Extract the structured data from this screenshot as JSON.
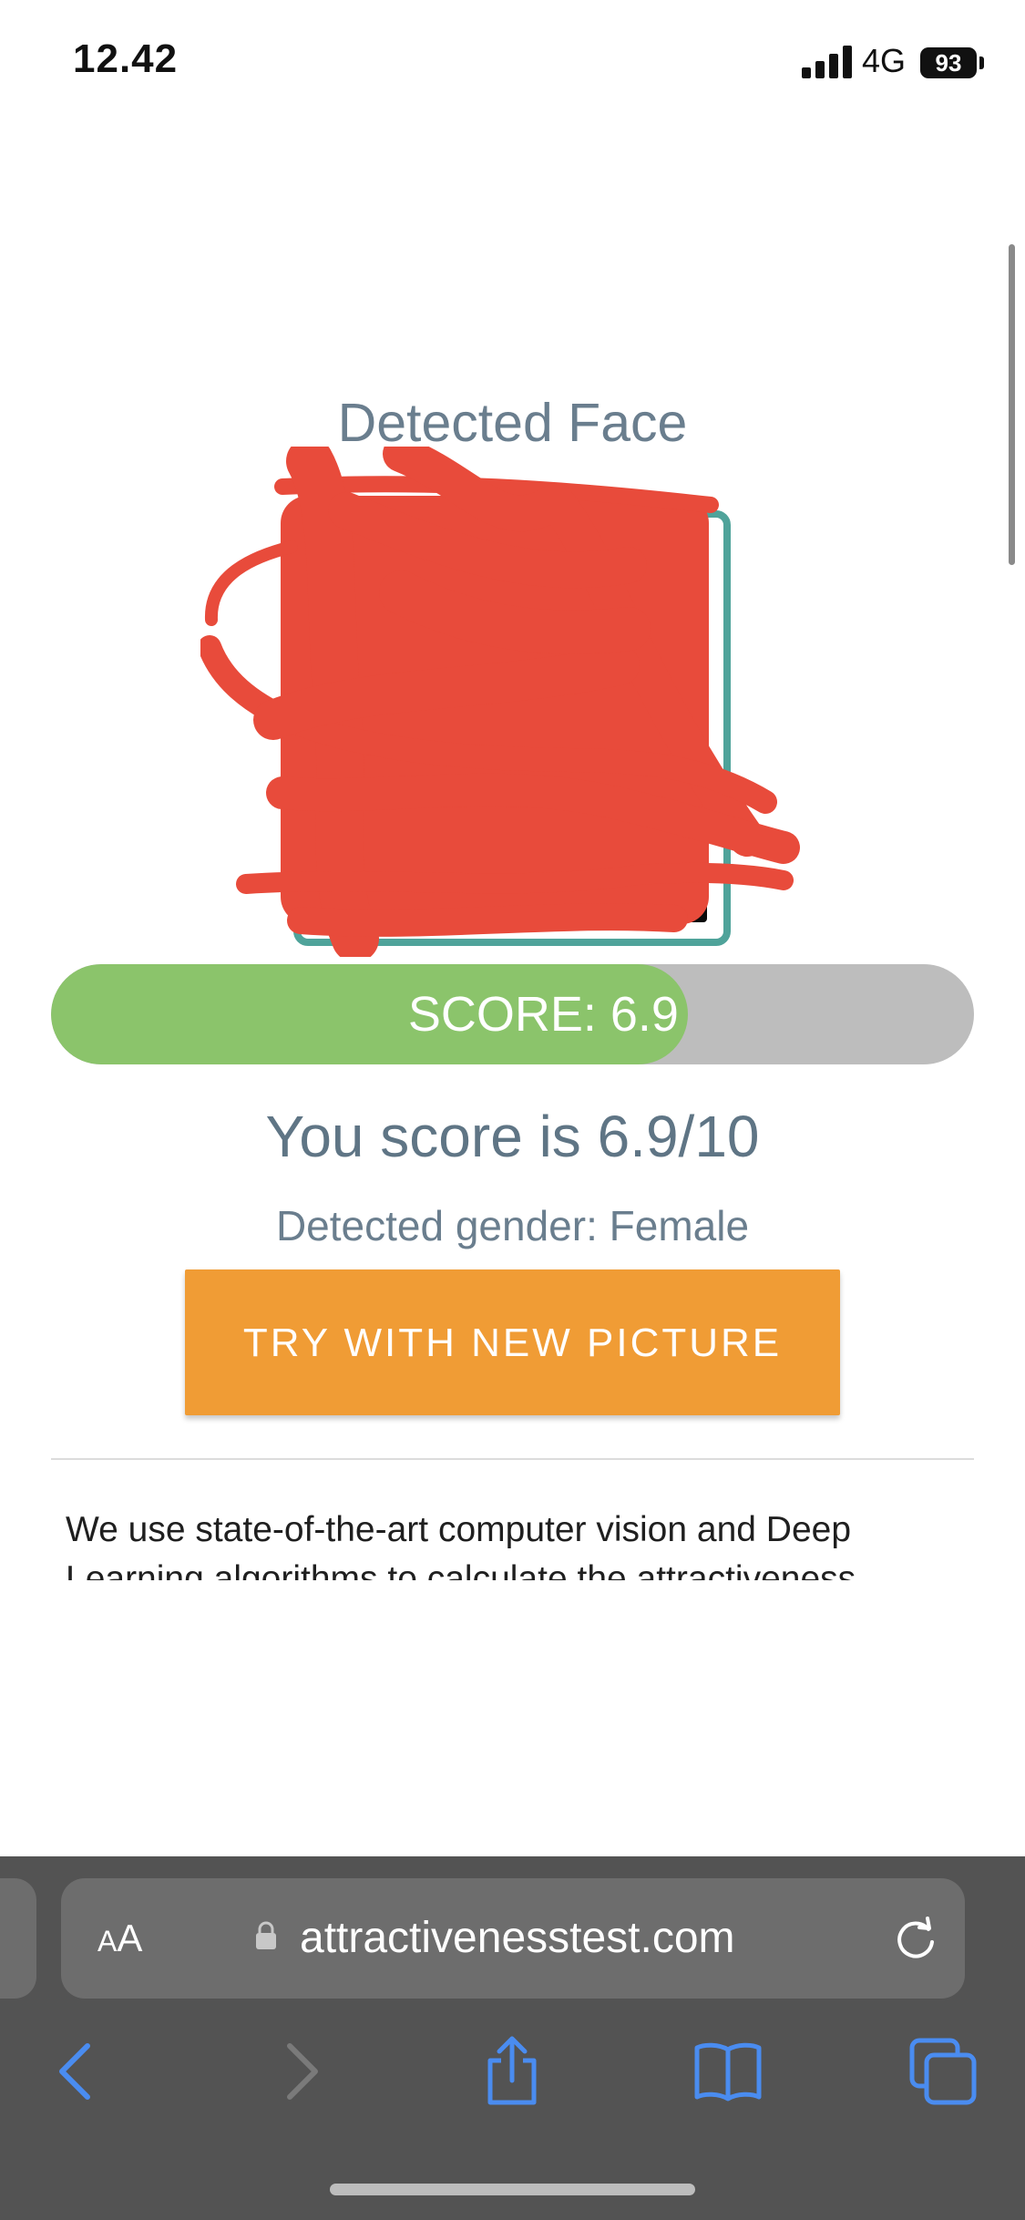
{
  "status_bar": {
    "time": "12.42",
    "network": "4G",
    "battery": "93"
  },
  "face_section": {
    "title": "Detected Face"
  },
  "score": {
    "bar_label": "SCORE: 6.9",
    "fraction": 0.69,
    "summary": "You score is 6.9/10",
    "gender": "Detected gender: Female"
  },
  "actions": {
    "try_label": "TRY WITH NEW PICTURE"
  },
  "description": "We use state-of-the-art computer vision and Deep Learning algorithms to calculate the attractiveness",
  "browser": {
    "aa_big": "A",
    "aa_small": "A",
    "url": "attractivenesstest.com"
  },
  "colors": {
    "accent_teal": "#4fa39a",
    "score_green": "#8bc46b",
    "button_orange": "#f09c35",
    "redaction_red": "#e84b3b",
    "ios_blue": "#4a8cf0"
  },
  "icons": {
    "back": "chevron-left-icon",
    "forward": "chevron-right-icon",
    "share": "share-icon",
    "bookmarks": "book-icon",
    "tabs": "tabs-icon",
    "reload": "reload-icon",
    "lock": "lock-icon"
  }
}
